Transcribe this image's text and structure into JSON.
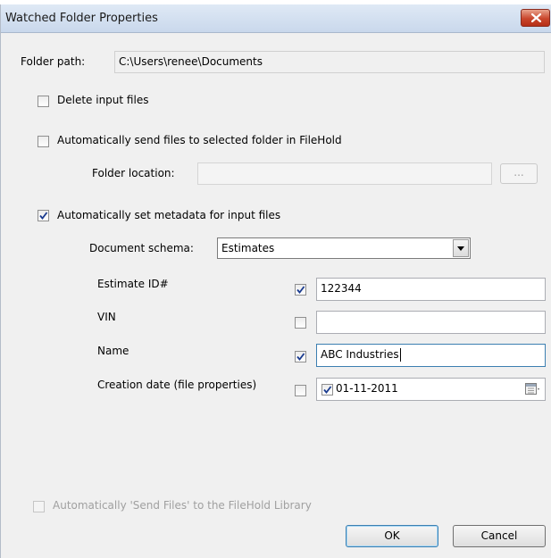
{
  "window": {
    "title": "Watched Folder Properties",
    "close_icon": "close-icon"
  },
  "folder_path": {
    "label": "Folder path:",
    "value": "C:\\Users\\renee\\Documents"
  },
  "delete_input_files": {
    "label": "Delete input files",
    "checked": false
  },
  "auto_send": {
    "label": "Automatically send files to selected folder in FileHold",
    "checked": false,
    "folder_location_label": "Folder location:",
    "folder_location_value": "",
    "browse_label": "..."
  },
  "auto_metadata": {
    "label": "Automatically set metadata for input files",
    "checked": true,
    "schema_label": "Document schema:",
    "schema_value": "Estimates",
    "fields": [
      {
        "name": "Estimate ID#",
        "checked": true,
        "value": "122344"
      },
      {
        "name": "VIN",
        "checked": false,
        "value": ""
      },
      {
        "name": "Name",
        "checked": true,
        "value": "ABC Industries"
      },
      {
        "name": "Creation date (file properties)",
        "checked": false,
        "date_checked": true,
        "value": "01-11-2011",
        "icon": "calendar-icon"
      }
    ]
  },
  "send_to_library": {
    "label": "Automatically 'Send Files' to the FileHold Library",
    "checked": false,
    "enabled": false
  },
  "buttons": {
    "ok": "OK",
    "cancel": "Cancel"
  },
  "colors": {
    "close_button": "#c9462c",
    "checkbox_check": "#1a3b8f",
    "default_button_border": "#3c7fb1"
  }
}
